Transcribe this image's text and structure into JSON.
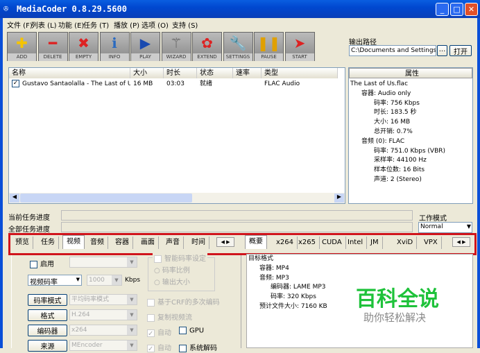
{
  "window": {
    "title": "MediaCoder 0.8.29.5600"
  },
  "menu": [
    "文件 (F)",
    "列表 (L)",
    "功能 (E)",
    "任务 (T)",
    "播放 (P)",
    "选项 (O)",
    "支持 (S)"
  ],
  "toolbar": [
    {
      "label": "ADD",
      "icon": "add-icon",
      "glyph": "✚",
      "color": "#f5c400"
    },
    {
      "label": "DELETE",
      "icon": "delete-icon",
      "glyph": "━",
      "color": "#d22"
    },
    {
      "label": "EMPTY",
      "icon": "empty-icon",
      "glyph": "✖",
      "color": "#d22"
    },
    {
      "label": "INFO",
      "icon": "info-icon",
      "glyph": "ℹ",
      "color": "#2a6ac0"
    },
    {
      "label": "PLAY",
      "icon": "play-icon",
      "glyph": "▶",
      "color": "#1a4ab0"
    },
    {
      "label": "WIZARD",
      "icon": "wand-icon",
      "glyph": "⚚",
      "color": "#555"
    },
    {
      "label": "EXTEND",
      "icon": "puzzle-icon",
      "glyph": "✿",
      "color": "#d22"
    },
    {
      "label": "SETTINGS",
      "icon": "wrench-icon",
      "glyph": "🔧",
      "color": "#444"
    },
    {
      "label": "PAUSE",
      "icon": "pause-icon",
      "glyph": "❚❚",
      "color": "#e0a000"
    },
    {
      "label": "START",
      "icon": "start-icon",
      "glyph": "➤",
      "color": "#d22"
    }
  ],
  "output": {
    "label": "输出路径",
    "path": "C:\\Documents and Settings\\A",
    "browse": "...",
    "open": "打开"
  },
  "list": {
    "columns": [
      "名称",
      "大小",
      "时长",
      "状态",
      "速率",
      "类型"
    ],
    "rows": [
      {
        "name": "Gustavo Santaolalla - The Last of Us",
        "size": "16 MB",
        "duration": "03:03",
        "status": "就绪",
        "speed": "",
        "type": "FLAC Audio"
      }
    ]
  },
  "properties": {
    "header": "属性",
    "file": "The Last of Us.flac",
    "container": "容器: Audio only",
    "items": [
      "码率: 756 Kbps",
      "时长: 183.5 秒",
      "大小: 16 MB",
      "总开销: 0.7%"
    ],
    "audio": "音频 (0): FLAC",
    "audio_items": [
      "码率: 751.0 Kbps (VBR)",
      "采样率: 44100 Hz",
      "样本位数: 16 Bits",
      "声道: 2 (Stereo)"
    ]
  },
  "progress": {
    "current": "当前任务进度",
    "total": "全部任务进度",
    "current_value": 0,
    "total_value": 0
  },
  "workmode": {
    "label": "工作模式",
    "value": "Normal"
  },
  "left_tabs": [
    "预览",
    "任务",
    "视频",
    "音频",
    "容器",
    "画面",
    "声音",
    "时间"
  ],
  "left_active": 2,
  "right_tabs": [
    "概要",
    "x264",
    "x265",
    "CUDA",
    "Intel",
    "JM",
    "XviD",
    "VPX"
  ],
  "video": {
    "enable": "启用",
    "bitrate_mode_select": "视频码率",
    "bitrate": "1000",
    "kbps": "Kbps",
    "smart": "智能码率设定",
    "ratio": "码率比例",
    "outsize": "输出大小",
    "rate_mode_btn": "码率模式",
    "rate_mode": "平均码率模式",
    "crf": "基于CRF的多次编码",
    "format_btn": "格式",
    "format": "H.264",
    "copy": "复制视频流",
    "encoder_btn": "编码器",
    "encoder": "x264",
    "auto": "自动",
    "gpu": "GPU",
    "source_btn": "来源",
    "source": "MEncoder",
    "auto2": "自动",
    "sysdecode": "系统解码"
  },
  "summary": {
    "title": "目标格式",
    "container": "容器: MP4",
    "audio": "音频: MP3",
    "encoder": "编码器: LAME MP3",
    "bitrate": "码率: 320 Kbps",
    "filesize": "预计文件大小: 7160 KB"
  },
  "watermark": {
    "title": "百科全说",
    "subtitle": "助你轻松解决"
  }
}
